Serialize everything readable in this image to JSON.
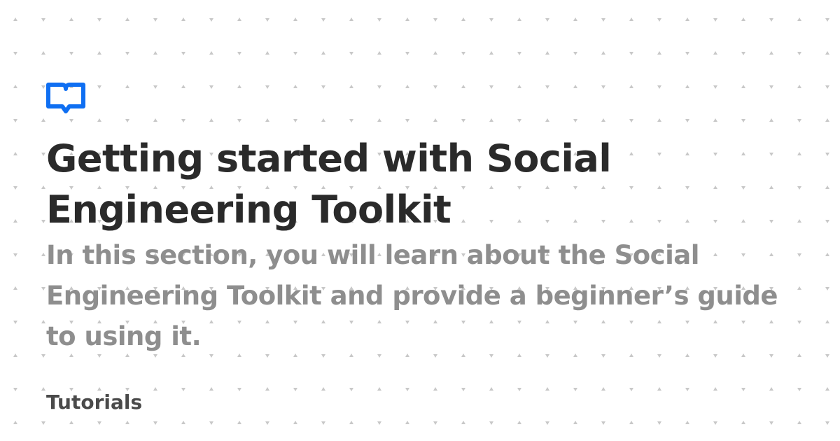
{
  "article": {
    "logo_icon": "open-book-icon",
    "title": "Getting started with Social Engineering Toolkit",
    "description": "In this section, you will learn about the Social Engineering Toolkit and provide a beginner’s guide to using it.",
    "category": "Tutorials"
  },
  "colors": {
    "accent": "#0f6ff2",
    "title": "#2a2a2a",
    "description": "#8e8e8e",
    "category": "#4a4a4a",
    "background": "#ffffff",
    "pattern": "#c8c8c8"
  }
}
